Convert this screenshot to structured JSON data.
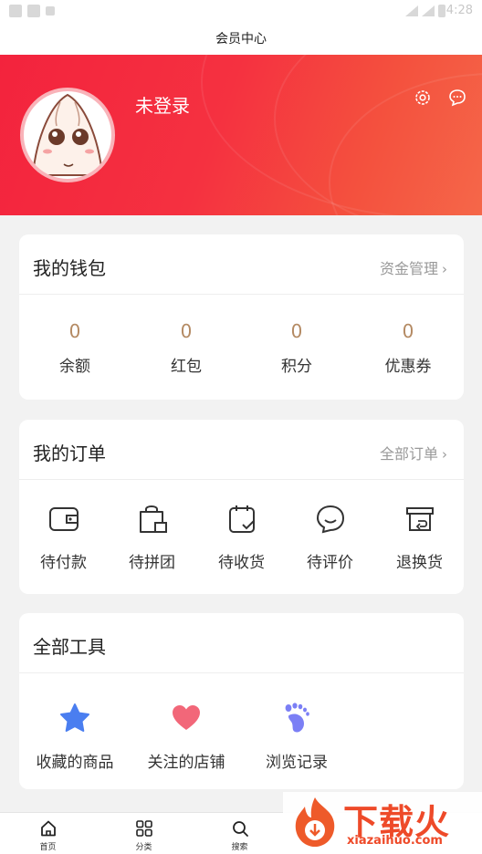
{
  "status_bar": {
    "time": "4:28"
  },
  "title_bar": {
    "title": "会员中心"
  },
  "profile": {
    "username": "未登录"
  },
  "wallet": {
    "title": "我的钱包",
    "link": "资金管理",
    "items": [
      {
        "value": "0",
        "label": "余额"
      },
      {
        "value": "0",
        "label": "红包"
      },
      {
        "value": "0",
        "label": "积分"
      },
      {
        "value": "0",
        "label": "优惠券"
      }
    ]
  },
  "orders": {
    "title": "我的订单",
    "link": "全部订单",
    "items": [
      {
        "label": "待付款",
        "icon": "wallet-icon"
      },
      {
        "label": "待拼团",
        "icon": "bag-icon"
      },
      {
        "label": "待收货",
        "icon": "calendar-check-icon"
      },
      {
        "label": "待评价",
        "icon": "comment-icon"
      },
      {
        "label": "退换货",
        "icon": "return-icon"
      }
    ]
  },
  "tools": {
    "title": "全部工具",
    "items": [
      {
        "label": "收藏的商品",
        "icon": "star-icon",
        "color": "#4a7ef0"
      },
      {
        "label": "关注的店铺",
        "icon": "heart-icon",
        "color": "#f26779"
      },
      {
        "label": "浏览记录",
        "icon": "footprint-icon",
        "color": "#7b7ff5"
      }
    ]
  },
  "tabbar": {
    "items": [
      {
        "label": "首页",
        "icon": "home-icon"
      },
      {
        "label": "分类",
        "icon": "category-grid-icon"
      },
      {
        "label": "搜索",
        "icon": "search-icon"
      }
    ]
  },
  "watermark": {
    "name_cn": "下载火",
    "domain": "xiazaihuo.com"
  },
  "colors": {
    "brand_red": "#f3233d",
    "accent_gold": "#b48a63"
  }
}
